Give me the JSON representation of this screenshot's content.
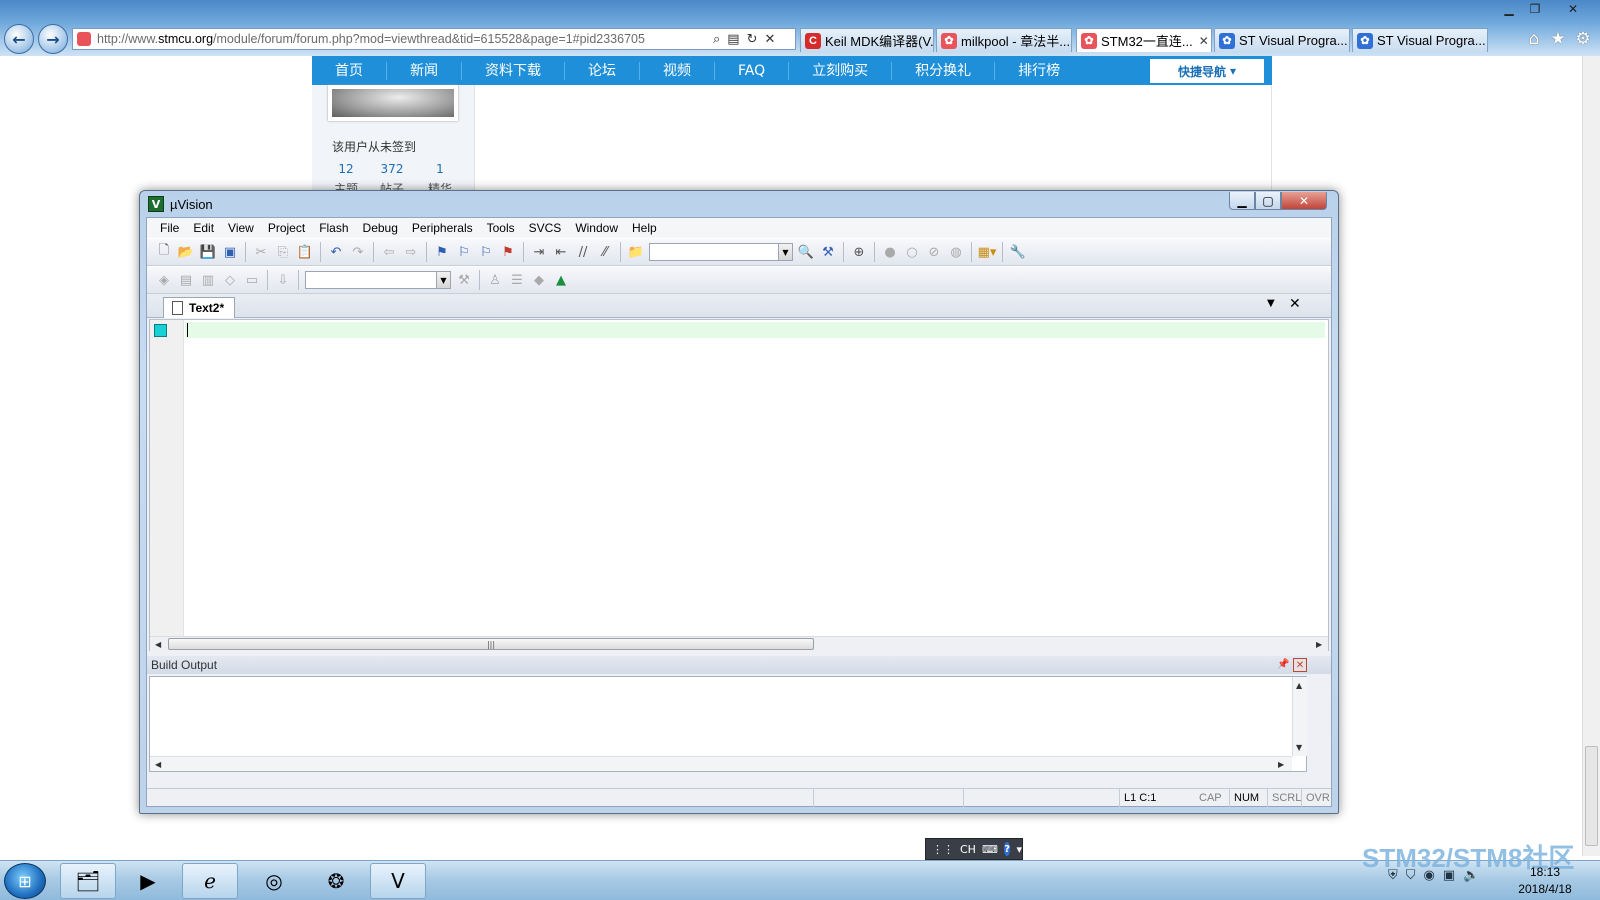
{
  "browser": {
    "url_prefix": "http://www.",
    "url_domain": "stmcu.org",
    "url_rest": "/module/forum/forum.php?mod=viewthread&tid=615528&page=1#pid2336705",
    "tabs": [
      {
        "label": "Keil MDK编译器(V...",
        "icon_color": "#d62b2b",
        "icon": "C"
      },
      {
        "label": "milkpool - 章法半...",
        "icon_color": "#e8545a",
        "icon": "✿"
      },
      {
        "label": "STM32一直连...",
        "icon_color": "#e8545a",
        "icon": "✿",
        "active": true,
        "close": "✕"
      },
      {
        "label": "ST Visual Progra...",
        "icon_color": "#2f6fd6",
        "icon": "✿"
      },
      {
        "label": "ST Visual Progra...",
        "icon_color": "#2f6fd6",
        "icon": "✿"
      }
    ],
    "icons": {
      "home": "home-icon",
      "favorites": "star-icon",
      "tools": "gear-icon"
    }
  },
  "site": {
    "nav": [
      "首页",
      "新闻",
      "资料下载",
      "论坛",
      "视频",
      "FAQ",
      "立刻购买",
      "积分换礼",
      "排行榜"
    ],
    "quick_nav": "快捷导航",
    "profile": {
      "signin": "该用户从未签到",
      "stats": [
        {
          "value": "12",
          "label": "主题"
        },
        {
          "value": "372",
          "label": "帖子"
        },
        {
          "value": "1",
          "label": "精华"
        }
      ]
    }
  },
  "uvision": {
    "title": "µVision",
    "menu": [
      "File",
      "Edit",
      "View",
      "Project",
      "Flash",
      "Debug",
      "Peripherals",
      "Tools",
      "SVCS",
      "Window",
      "Help"
    ],
    "editor_tab": "Text2*",
    "build_output_title": "Build Output",
    "status": {
      "position": "L1 C:1",
      "cap": "CAP",
      "num": "NUM",
      "scrl": "SCRL",
      "ovr": "OVR"
    }
  },
  "langbar": {
    "lang": "CH",
    "help": "?"
  },
  "taskbar": {
    "apps": [
      "file-explorer-icon",
      "media-player-icon",
      "internet-explorer-icon",
      "chrome-icon",
      "baidu-netdisk-icon",
      "uvision-icon"
    ],
    "watermark": "STM32/STM8社区",
    "clock_time": "18:13",
    "clock_date": "2018/4/18"
  }
}
